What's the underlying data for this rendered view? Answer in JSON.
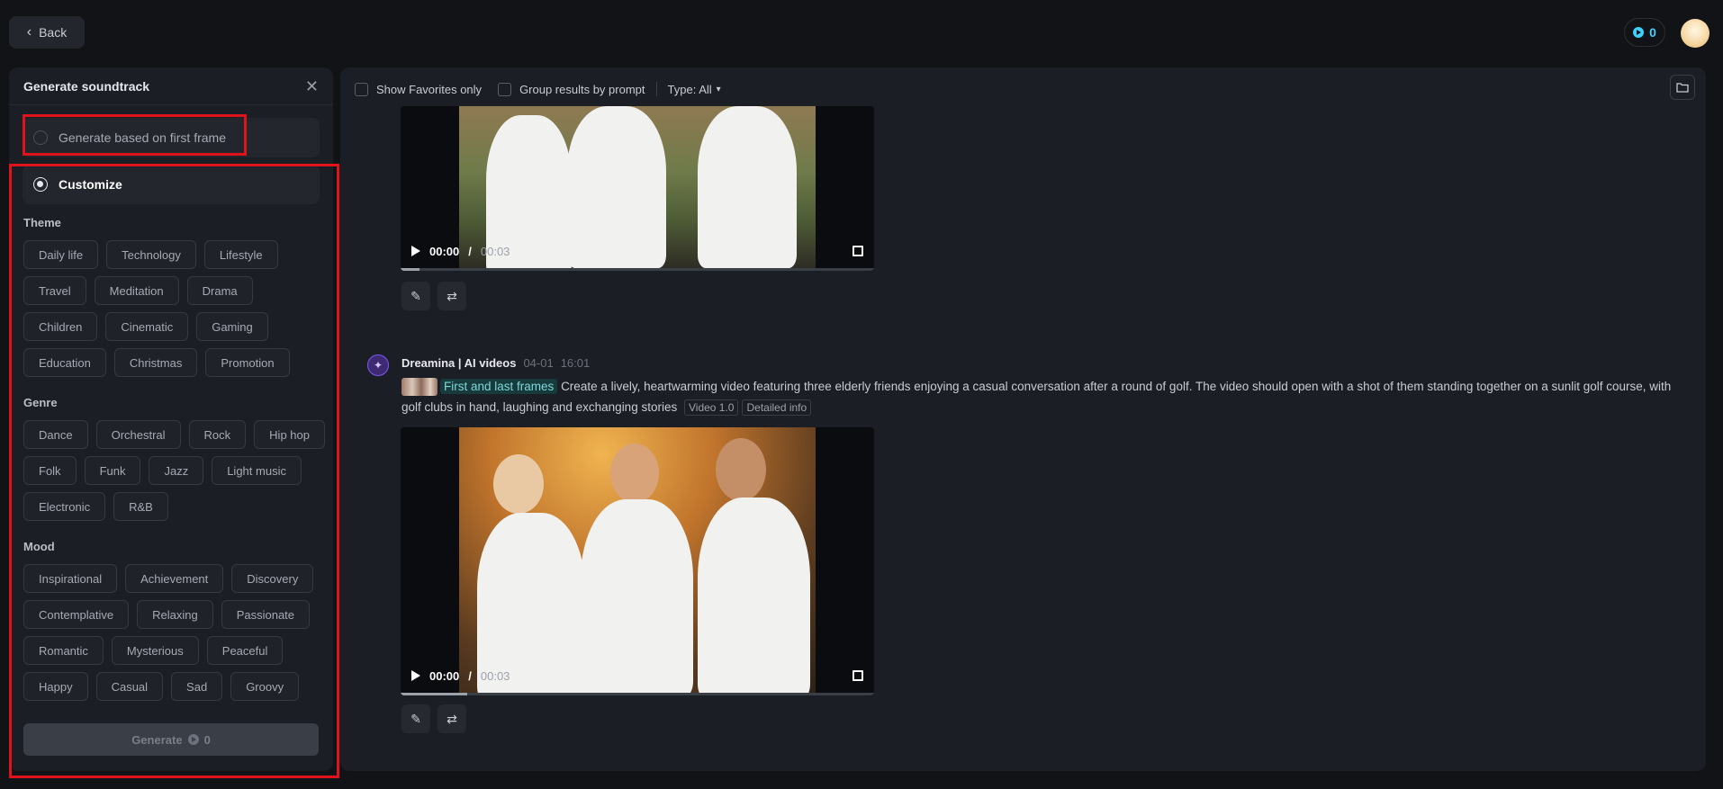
{
  "topbar": {
    "back_label": "Back",
    "credits": "0"
  },
  "panel": {
    "title": "Generate soundtrack",
    "options": [
      {
        "label": "Generate based on first frame",
        "selected": false
      },
      {
        "label": "Customize",
        "selected": true
      }
    ],
    "theme": {
      "title": "Theme",
      "chips": [
        "Daily life",
        "Technology",
        "Lifestyle",
        "Travel",
        "Meditation",
        "Drama",
        "Children",
        "Cinematic",
        "Gaming",
        "Education",
        "Christmas",
        "Promotion"
      ]
    },
    "genre": {
      "title": "Genre",
      "chips": [
        "Dance",
        "Orchestral",
        "Rock",
        "Hip hop",
        "Folk",
        "Funk",
        "Jazz",
        "Light music",
        "Electronic",
        "R&B"
      ]
    },
    "mood": {
      "title": "Mood",
      "chips": [
        "Inspirational",
        "Achievement",
        "Discovery",
        "Contemplative",
        "Relaxing",
        "Passionate",
        "Romantic",
        "Mysterious",
        "Peaceful",
        "Happy",
        "Casual",
        "Sad",
        "Groovy"
      ]
    },
    "generate_label": "Generate",
    "generate_cost": "0"
  },
  "filters": {
    "favorites_label": "Show Favorites only",
    "group_label": "Group results by prompt",
    "type_label": "Type: All"
  },
  "videos": [
    {
      "time_current": "00:00",
      "time_total": "00:03",
      "progress": 0.04
    },
    {
      "time_current": "00:00",
      "time_total": "00:03",
      "progress": 0.14
    }
  ],
  "message": {
    "author": "Dreamina | AI videos",
    "date": "04-01",
    "time": "16:01",
    "frames_tag": "First and last frames",
    "prompt": "Create a lively, heartwarming video featuring three elderly friends enjoying a casual conversation after a round of golf. The video should open with a shot of them standing together on a sunlit golf course, with golf clubs in hand, laughing and exchanging stories",
    "version_tag": "Video 1.0",
    "info_tag": "Detailed info"
  },
  "colors": {
    "accent": "#3fd0ff",
    "highlight": "#e0131c",
    "brand": "#7a5cf0"
  }
}
